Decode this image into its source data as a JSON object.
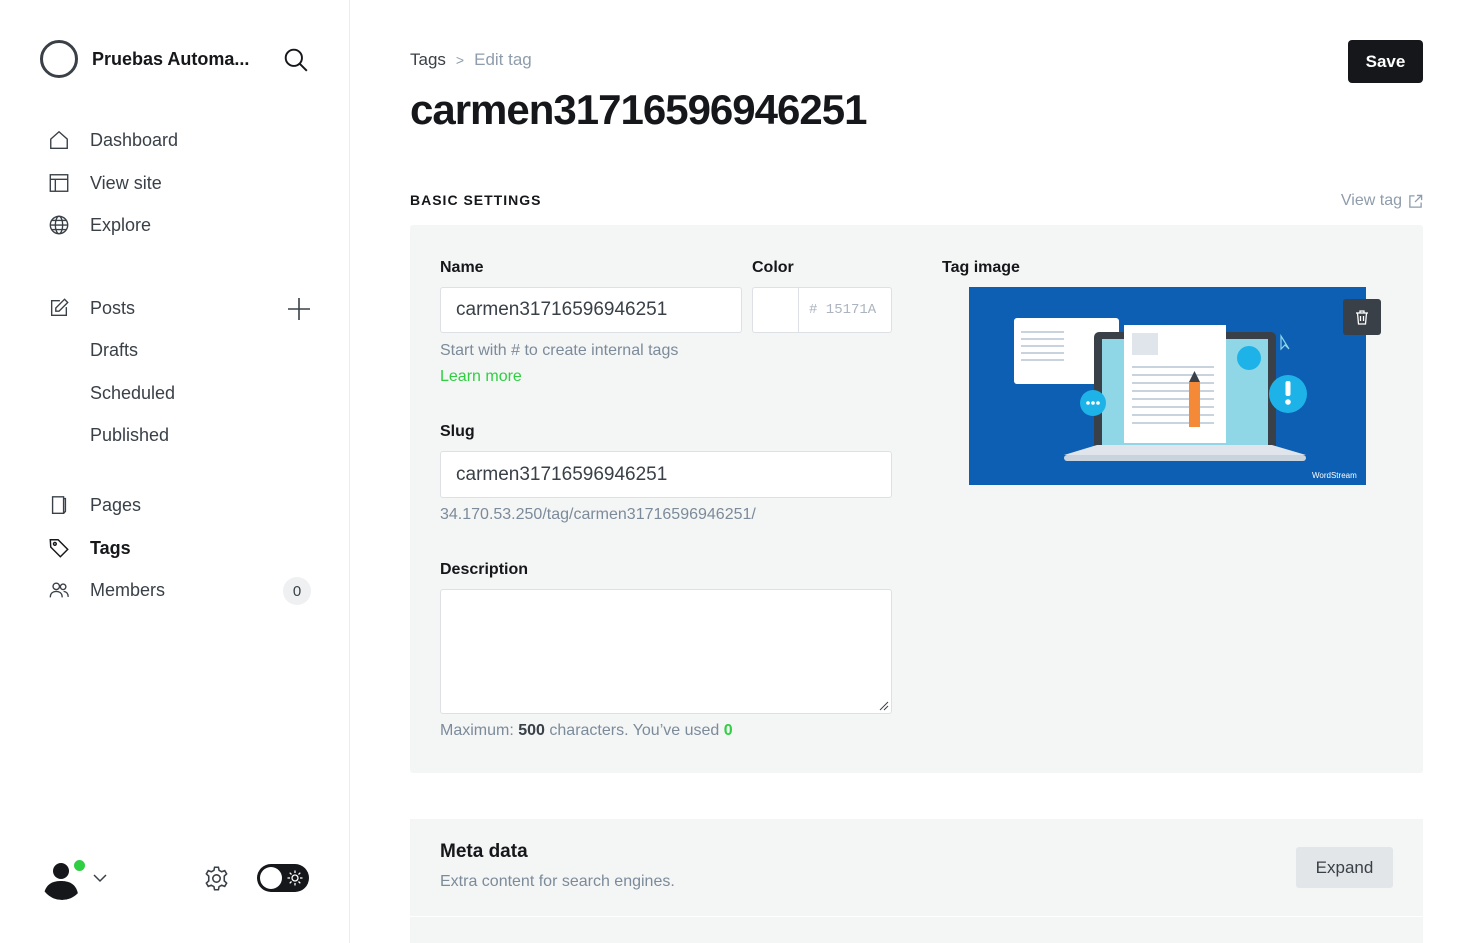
{
  "sidebar": {
    "site_title": "Pruebas Automa...",
    "nav": {
      "dashboard": "Dashboard",
      "view_site": "View site",
      "explore": "Explore",
      "posts": "Posts",
      "drafts": "Drafts",
      "scheduled": "Scheduled",
      "published": "Published",
      "pages": "Pages",
      "tags": "Tags",
      "members": "Members",
      "members_count": "0"
    },
    "active_item": "Tags"
  },
  "header": {
    "breadcrumb_parent": "Tags",
    "breadcrumb_current": "Edit tag",
    "title": "carmen31716596946251",
    "save_label": "Save"
  },
  "basic_settings": {
    "section_label": "BASIC SETTINGS",
    "view_tag_label": "View tag",
    "name_label": "Name",
    "name_value": "carmen31716596946251",
    "name_hint": "Start with # to create internal tags",
    "learn_more": "Learn more",
    "color_label": "Color",
    "color_placeholder": "# 15171A",
    "slug_label": "Slug",
    "slug_value": "carmen31716596946251",
    "slug_url": "34.170.53.250/tag/carmen31716596946251/",
    "description_label": "Description",
    "description_value": "",
    "counter_prefix": "Maximum:",
    "counter_max": "500",
    "counter_middle": "characters. You’ve used",
    "counter_used": "0",
    "tag_image_label": "Tag image",
    "tag_image_watermark": "WordStream"
  },
  "meta_data": {
    "title": "Meta data",
    "subtitle": "Extra content for search engines.",
    "expand_label": "Expand"
  },
  "colors": {
    "accent_green": "#30cf43",
    "dark": "#15171a",
    "panel_bg": "#f4f5f5",
    "image_blue": "#0d5fb3"
  }
}
